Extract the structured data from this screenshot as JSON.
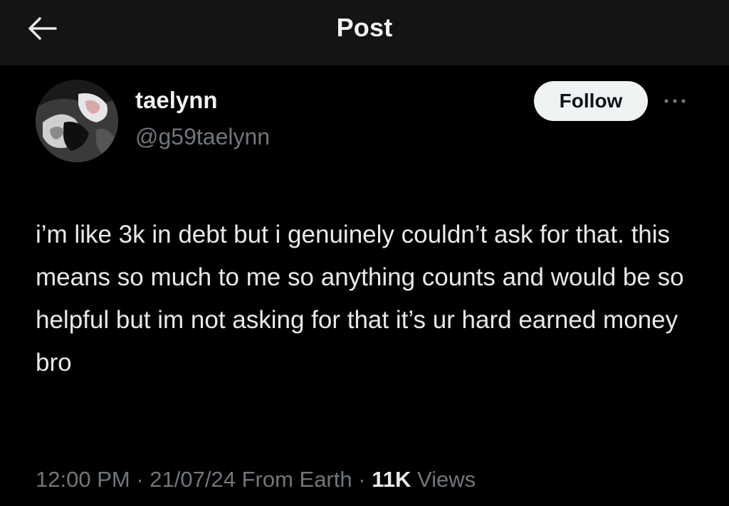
{
  "header": {
    "title": "Post",
    "back_icon": "arrow-left-icon"
  },
  "author": {
    "display_name": "taelynn",
    "handle": "@g59taelynn",
    "avatar": "profile-photo"
  },
  "actions": {
    "follow_label": "Follow",
    "more_icon": "more-horizontal-icon"
  },
  "post": {
    "text": "i’m like 3k in debt but i genuinely couldn’t ask for that. this means so much to me so anything counts and would be so helpful but im not asking for that it’s ur hard earned money bro"
  },
  "meta": {
    "time": "12:00 PM",
    "separator": "·",
    "date": "21/07/24",
    "source": "From Earth",
    "views_count": "11K",
    "views_label": "Views"
  },
  "colors": {
    "background": "#000000",
    "header_background": "#141414",
    "text_primary": "#e7e9ea",
    "text_secondary": "#71767b",
    "follow_button_bg": "#eff3f4"
  }
}
